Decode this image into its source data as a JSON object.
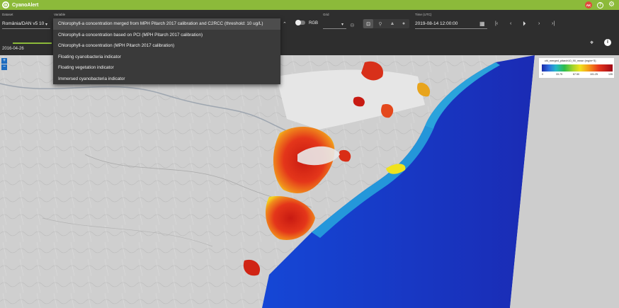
{
  "app": {
    "title": "CyanoAlert",
    "user_initials": "AK",
    "help_glyph": "?",
    "settings_glyph": "⚙"
  },
  "toolbar": {
    "dataset_label": "Dataset",
    "dataset_value": "România/DAN v5 10",
    "variable_label": "Variable",
    "rgb_label": "RGB",
    "grid_label": "Grid",
    "time_label": "Time (UTC)",
    "time_value": "2019-08-14 12:00:00"
  },
  "timeline": {
    "date": "2016-04-26"
  },
  "variable_menu": {
    "selected": "Chlorophyll-a concentration merged from MPH Pitarch 2017 calibration and C2RCC (threshold: 10 ug/L)",
    "options": [
      "Chlorophyll-a concentration merged from MPH Pitarch 2017 calibration and C2RCC (threshold: 10 ug/L)",
      "Chlorophyll-a concentration based on PCI (MPH Pitarch 2017 calibration)",
      "Chlorophyll-a concentration (MPH Pitarch 2017 calibration)",
      "Floating cyanobacteria indicator",
      "Floating vegetation indicator",
      "Immersed cyanobacteria indicator"
    ]
  },
  "legend": {
    "title": "chl_merged_pitarch10_90_mean (mg/m^3)",
    "ticks": [
      "0",
      "33.75",
      "67.50",
      "101.25",
      "135"
    ]
  },
  "zoom": {
    "in": "+",
    "out": "−"
  },
  "icons": [
    "cyanoalert-logo-icon",
    "help-icon",
    "gear-icon",
    "chevron-down-icon",
    "timeseries-icon",
    "calendar-icon",
    "first-icon",
    "prev-icon",
    "play-icon",
    "next-icon",
    "last-icon",
    "location-icon",
    "info-icon"
  ]
}
